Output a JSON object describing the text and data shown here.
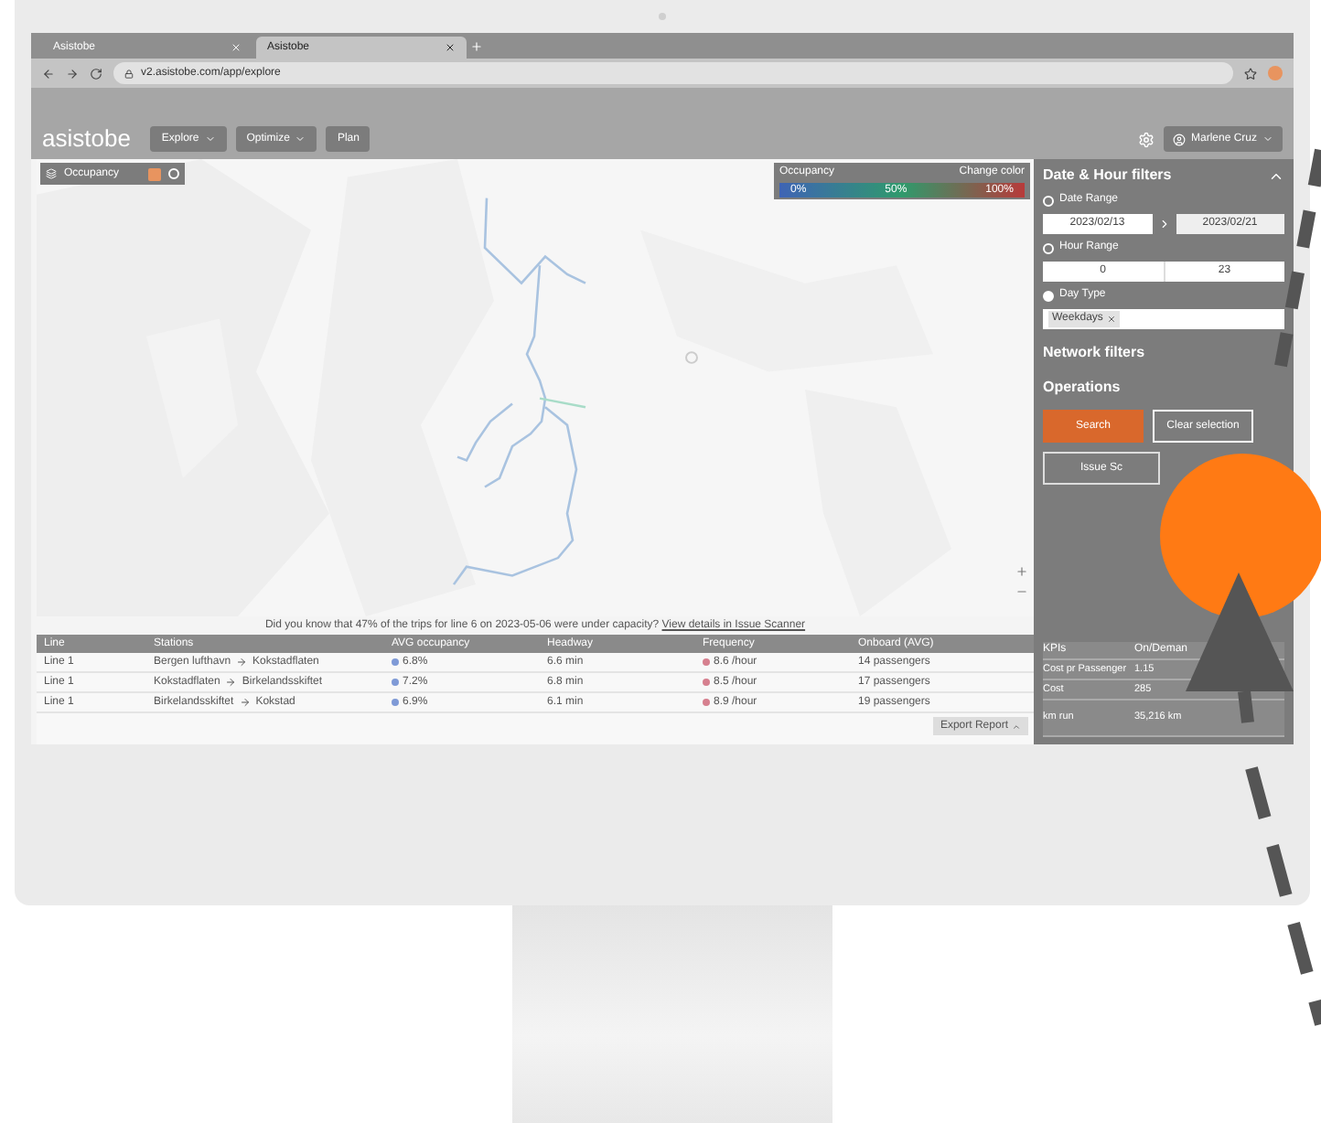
{
  "browser": {
    "tabs": [
      {
        "title": "Asistobe",
        "selected": false
      },
      {
        "title": "Asistobe",
        "selected": true
      }
    ],
    "url": "v2.asistobe.com/app/explore"
  },
  "app": {
    "logo": "asistobe",
    "nav": [
      {
        "label": "Explore",
        "dropdown": true
      },
      {
        "label": "Optimize",
        "dropdown": true
      },
      {
        "label": "Plan",
        "dropdown": false
      }
    ],
    "user": "Marlene Cruz"
  },
  "map": {
    "layer": "Occupancy",
    "legend": {
      "title": "Occupancy",
      "action": "Change color",
      "ticks": [
        "0%",
        "50%",
        "100%"
      ]
    }
  },
  "banner": {
    "text": "Did you know that 47% of the trips for line 6 on 2023-05-06 were under capacity?",
    "link": "View details in Issue Scanner"
  },
  "table": {
    "columns": [
      "Line",
      "Stations",
      "AVG occupancy",
      "Headway",
      "Frequency",
      "Onboard (AVG)"
    ],
    "rows": [
      {
        "line": "Line 1",
        "from": "Bergen lufthavn",
        "to": "Kokstadflaten",
        "occupancy": "6.8%",
        "headway": "6.6 min",
        "frequency": "8.6 /hour",
        "onboard": "14 passengers"
      },
      {
        "line": "Line 1",
        "from": "Kokstadflaten",
        "to": "Birkelandsskiftet",
        "occupancy": "7.2%",
        "headway": "6.8 min",
        "frequency": "8.5 /hour",
        "onboard": "17 passengers"
      },
      {
        "line": "Line 1",
        "from": "Birkelandsskiftet",
        "to": "Kokstad",
        "occupancy": "6.9%",
        "headway": "6.1 min",
        "frequency": "8.9 /hour",
        "onboard": "19 passengers"
      }
    ]
  },
  "export_button": "Export Report",
  "filters": {
    "title": "Date & Hour filters",
    "expanded": true,
    "date_range": {
      "label": "Date Range",
      "checked": false,
      "from": "2023/02/13",
      "to": "2023/02/21"
    },
    "hour_range": {
      "label": "Hour Range",
      "checked": false,
      "from": "0",
      "to": "23"
    },
    "day_type": {
      "label": "Day Type",
      "checked": true,
      "tags": [
        "Weekdays"
      ]
    }
  },
  "sections": [
    "Network filters",
    "Operations"
  ],
  "buttons": {
    "search": "Search",
    "clear": "Clear selection",
    "issue": "Issue Sc"
  },
  "kpis": {
    "columns": [
      "KPIs",
      "On/Deman"
    ],
    "rows": [
      [
        "Cost pr Passenger",
        "1.15"
      ],
      [
        "Cost",
        "285"
      ],
      [
        "km run",
        "35,216 km"
      ]
    ]
  }
}
